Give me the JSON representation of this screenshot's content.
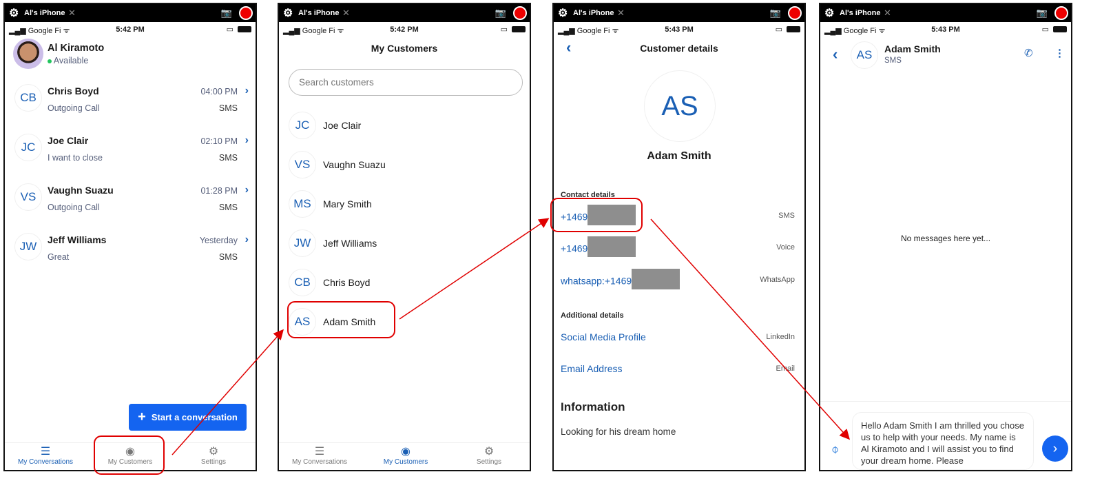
{
  "device": {
    "name": "Al's iPhone",
    "carrier": "Google Fi"
  },
  "colors": {
    "accent": "#1a5fb4",
    "button": "#1464f0",
    "annotation": "#e00000",
    "available": "#22c55e"
  },
  "nav": {
    "conversations": "My Conversations",
    "customers": "My Customers",
    "settings": "Settings"
  },
  "screen1": {
    "time": "5:42 PM",
    "user": {
      "name": "Al Kiramoto",
      "status": "Available"
    },
    "conversations": [
      {
        "initials": "CB",
        "name": "Chris Boyd",
        "preview": "Outgoing Call",
        "time": "04:00 PM",
        "channel": "SMS"
      },
      {
        "initials": "JC",
        "name": "Joe Clair",
        "preview": "I want to close",
        "time": "02:10 PM",
        "channel": "SMS"
      },
      {
        "initials": "VS",
        "name": "Vaughn Suazu",
        "preview": "Outgoing Call",
        "time": "01:28 PM",
        "channel": "SMS"
      },
      {
        "initials": "JW",
        "name": "Jeff Williams",
        "preview": "Great",
        "time": "Yesterday",
        "channel": "SMS"
      }
    ],
    "start_button": "Start a conversation"
  },
  "screen2": {
    "time": "5:42 PM",
    "title": "My Customers",
    "search_placeholder": "Search customers",
    "customers": [
      {
        "initials": "JC",
        "name": "Joe Clair"
      },
      {
        "initials": "VS",
        "name": "Vaughn Suazu"
      },
      {
        "initials": "MS",
        "name": "Mary Smith"
      },
      {
        "initials": "JW",
        "name": "Jeff Williams"
      },
      {
        "initials": "CB",
        "name": "Chris Boyd"
      },
      {
        "initials": "AS",
        "name": "Adam Smith"
      }
    ]
  },
  "screen3": {
    "time": "5:43 PM",
    "title": "Customer details",
    "initials": "AS",
    "name": "Adam Smith",
    "contact_label": "Contact details",
    "contacts": [
      {
        "value": "+1469",
        "type": "SMS"
      },
      {
        "value": "+1469",
        "type": "Voice"
      },
      {
        "value": "whatsapp:+1469",
        "type": "WhatsApp"
      }
    ],
    "additional_label": "Additional details",
    "additional": [
      {
        "value": "Social Media Profile",
        "type": "LinkedIn"
      },
      {
        "value": "Email Address",
        "type": "Email"
      }
    ],
    "info_title": "Information",
    "info_text": "Looking for his dream home"
  },
  "screen4": {
    "time": "5:43 PM",
    "initials": "AS",
    "name": "Adam Smith",
    "channel": "SMS",
    "empty": "No messages here yet...",
    "draft": "Hello Adam Smith I am thrilled you chose us to help with your needs. My name is Al Kiramoto and I will assist you to find your dream home. Please"
  }
}
